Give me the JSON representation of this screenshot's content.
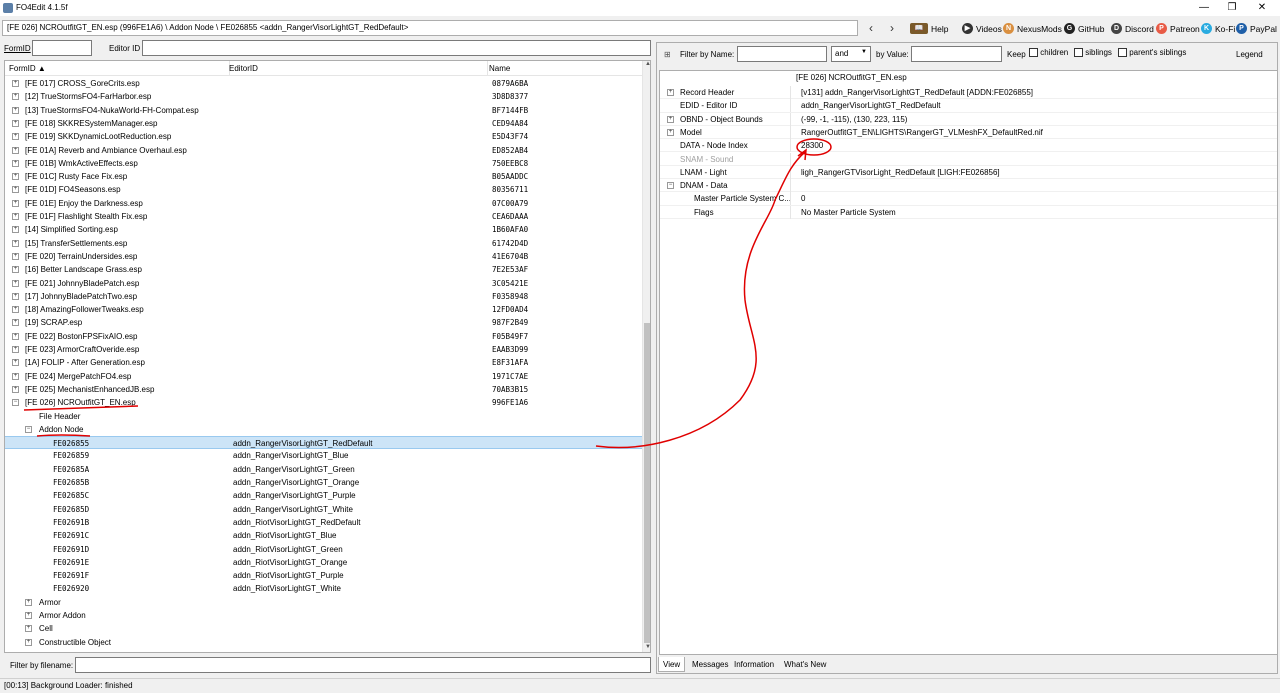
{
  "window": {
    "title": "FO4Edit 4.1.5f",
    "minimize": "—",
    "maximize": "❐",
    "close": "✕"
  },
  "pathbar": {
    "path": "[FE 026] NCROutfitGT_EN.esp (996FE1A6) \\ Addon Node \\ FE026855 <addn_RangerVisorLightGT_RedDefault>"
  },
  "toolbar": {
    "back": "‹",
    "forward": "›",
    "help": "Help",
    "videos": "Videos",
    "nexusmods": "NexusMods",
    "github": "GitHub",
    "discord": "Discord",
    "patreon": "Patreon",
    "kofi": "Ko-Fi",
    "paypal": "PayPal"
  },
  "left": {
    "formid_label": "FormID",
    "editorid_label": "Editor ID",
    "columns": {
      "formid": "FormID ▲",
      "editorid": "EditorID",
      "name": "Name"
    },
    "filter_label": "Filter by filename:"
  },
  "tree_rows": [
    {
      "id": "[FE 017] CROSS_GoreCrits.esp",
      "name": "0879A6BA",
      "exp": "+"
    },
    {
      "id": "[12] TrueStormsFO4-FarHarbor.esp",
      "name": "3D8D8377",
      "exp": "+"
    },
    {
      "id": "[13] TrueStormsFO4-NukaWorld-FH-Compat.esp",
      "name": "BF7144FB",
      "exp": "+"
    },
    {
      "id": "[FE 018] SKKRESystemManager.esp",
      "name": "CED94A84",
      "exp": "+"
    },
    {
      "id": "[FE 019] SKKDynamicLootReduction.esp",
      "name": "E5D43F74",
      "exp": "+"
    },
    {
      "id": "[FE 01A] Reverb and Ambiance Overhaul.esp",
      "name": "ED852AB4",
      "exp": "+"
    },
    {
      "id": "[FE 01B] WmkActiveEffects.esp",
      "name": "750EEBC8",
      "exp": "+"
    },
    {
      "id": "[FE 01C] Rusty Face Fix.esp",
      "name": "B05AADDC",
      "exp": "+"
    },
    {
      "id": "[FE 01D] FO4Seasons.esp",
      "name": "80356711",
      "exp": "+"
    },
    {
      "id": "[FE 01E] Enjoy the Darkness.esp",
      "name": "07C00A79",
      "exp": "+"
    },
    {
      "id": "[FE 01F] Flashlight Stealth Fix.esp",
      "name": "CEA6DAAA",
      "exp": "+"
    },
    {
      "id": "[14] Simplified Sorting.esp",
      "name": "1B60AFA0",
      "exp": "+"
    },
    {
      "id": "[15] TransferSettlements.esp",
      "name": "61742D4D",
      "exp": "+"
    },
    {
      "id": "[FE 020] TerrainUndersides.esp",
      "name": "41E6704B",
      "exp": "+"
    },
    {
      "id": "[16] Better Landscape Grass.esp",
      "name": "7E2E53AF",
      "exp": "+"
    },
    {
      "id": "[FE 021] JohnnyBladePatch.esp",
      "name": "3C05421E",
      "exp": "+"
    },
    {
      "id": "[17] JohnnyBladePatchTwo.esp",
      "name": "F0358948",
      "exp": "+"
    },
    {
      "id": "[18] AmazingFollowerTweaks.esp",
      "name": "12FD0AD4",
      "exp": "+"
    },
    {
      "id": "[19] SCRAP.esp",
      "name": "987F2B49",
      "exp": "+"
    },
    {
      "id": "[FE 022] BostonFPSFixAIO.esp",
      "name": "F05B49F7",
      "exp": "+"
    },
    {
      "id": "[FE 023] ArmorCraftOveride.esp",
      "name": "EAAB3D99",
      "exp": "+"
    },
    {
      "id": "[1A] FOLIP - After Generation.esp",
      "name": "E8F31AFA",
      "exp": "+"
    },
    {
      "id": "[FE 024] MergePatchFO4.esp",
      "name": "1971C7AE",
      "exp": "+"
    },
    {
      "id": "[FE 025] MechanistEnhancedJB.esp",
      "name": "70AB3B15",
      "exp": "+"
    },
    {
      "id": "[FE 026] NCROutfitGT_EN.esp",
      "name": "996FE1A6",
      "exp": "−"
    }
  ],
  "sub_rows": [
    {
      "id": "File Header",
      "editor": ""
    },
    {
      "id": "Addon Node",
      "editor": "",
      "exp": "−"
    }
  ],
  "addon_rows": [
    {
      "id": "FE026855",
      "editor": "addn_RangerVisorLightGT_RedDefault"
    },
    {
      "id": "FE026859",
      "editor": "addn_RangerVisorLightGT_Blue"
    },
    {
      "id": "FE02685A",
      "editor": "addn_RangerVisorLightGT_Green"
    },
    {
      "id": "FE02685B",
      "editor": "addn_RangerVisorLightGT_Orange"
    },
    {
      "id": "FE02685C",
      "editor": "addn_RangerVisorLightGT_Purple"
    },
    {
      "id": "FE02685D",
      "editor": "addn_RangerVisorLightGT_White"
    },
    {
      "id": "FE02691B",
      "editor": "addn_RiotVisorLightGT_RedDefault"
    },
    {
      "id": "FE02691C",
      "editor": "addn_RiotVisorLightGT_Blue"
    },
    {
      "id": "FE02691D",
      "editor": "addn_RiotVisorLightGT_Green"
    },
    {
      "id": "FE02691E",
      "editor": "addn_RiotVisorLightGT_Orange"
    },
    {
      "id": "FE02691F",
      "editor": "addn_RiotVisorLightGT_Purple"
    },
    {
      "id": "FE026920",
      "editor": "addn_RiotVisorLightGT_White"
    }
  ],
  "group_rows": [
    {
      "id": "Armor",
      "exp": "+"
    },
    {
      "id": "Armor Addon",
      "exp": "+"
    },
    {
      "id": "Cell",
      "exp": "+"
    },
    {
      "id": "Constructible Object",
      "exp": "+"
    }
  ],
  "right": {
    "filter_name_label": "Filter by Name:",
    "and_option": "and",
    "by_value_label": "by Value:",
    "keep_label": "Keep",
    "children_label": "children",
    "siblings_label": "siblings",
    "parents_label": "parent's siblings",
    "legend_label": "Legend",
    "record_header_file": "[FE 026] NCROutfitGT_EN.esp"
  },
  "props": [
    {
      "k": "Record Header",
      "v": "[v131] addn_RangerVisorLightGT_RedDefault [ADDN:FE026855]",
      "exp": "+"
    },
    {
      "k": "EDID - Editor ID",
      "v": "addn_RangerVisorLightGT_RedDefault"
    },
    {
      "k": "OBND - Object Bounds",
      "v": "(-99, -1, -115), (130, 223, 115)",
      "exp": "+"
    },
    {
      "k": "Model",
      "v": "RangerOutfitGT_EN\\LIGHTS\\RangerGT_VLMeshFX_DefaultRed.nif",
      "exp": "+"
    },
    {
      "k": "DATA - Node Index",
      "v": "28300"
    },
    {
      "k": "SNAM - Sound",
      "v": "",
      "disabled": true
    },
    {
      "k": "LNAM - Light",
      "v": "ligh_RangerGTVisorLight_RedDefault [LIGH:FE026856]"
    },
    {
      "k": "DNAM - Data",
      "v": "",
      "exp": "−"
    },
    {
      "k": "Master Particle System C...",
      "v": "0",
      "indent": true
    },
    {
      "k": "Flags",
      "v": "No Master Particle System",
      "indent": true
    }
  ],
  "tabs": {
    "view": "View",
    "messages": "Messages",
    "information": "Information",
    "whats_new": "What's New"
  },
  "status": {
    "text": "[00:13] Background Loader: finished"
  },
  "colors": {
    "selection": "#cce4f7",
    "annotation": "#e00000"
  }
}
